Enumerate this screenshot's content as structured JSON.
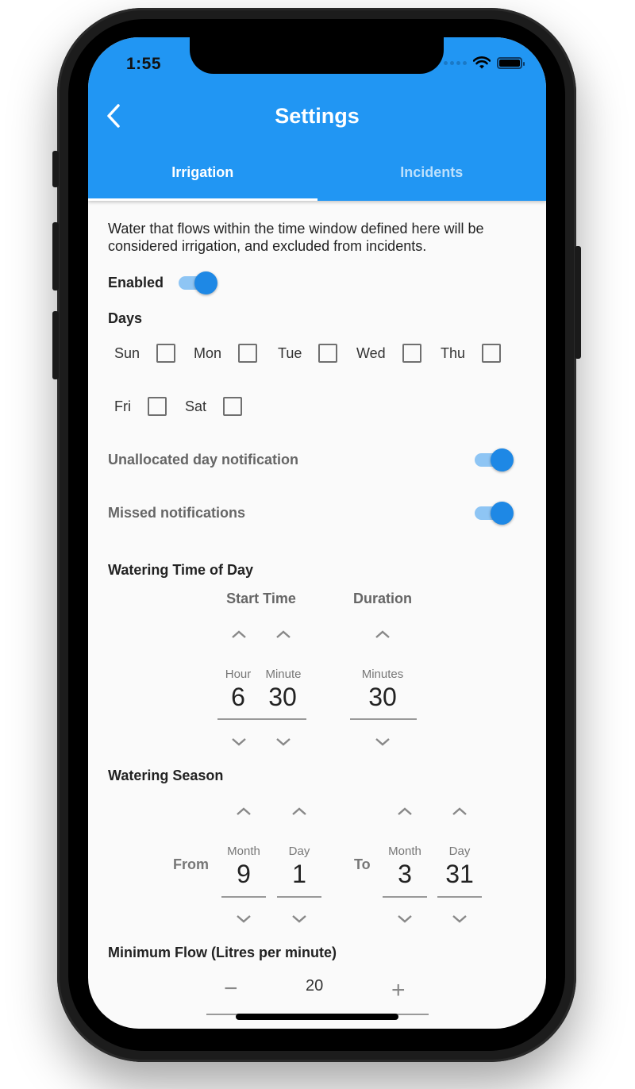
{
  "status_bar": {
    "time": "1:55"
  },
  "appbar": {
    "title": "Settings",
    "back_icon": "chevron-left-icon",
    "tabs": [
      {
        "label": "Irrigation",
        "active": true
      },
      {
        "label": "Incidents",
        "active": false
      }
    ]
  },
  "irrigation": {
    "description": "Water that flows within the time window defined here will be considered irrigation, and excluded from incidents.",
    "enabled": {
      "label": "Enabled",
      "value": true
    },
    "days": {
      "label": "Days",
      "items": [
        {
          "label": "Sun",
          "checked": false
        },
        {
          "label": "Mon",
          "checked": false
        },
        {
          "label": "Tue",
          "checked": false
        },
        {
          "label": "Wed",
          "checked": false
        },
        {
          "label": "Thu",
          "checked": false
        },
        {
          "label": "Fri",
          "checked": false
        },
        {
          "label": "Sat",
          "checked": false
        }
      ]
    },
    "unallocated_notification": {
      "label": "Unallocated day notification",
      "value": true
    },
    "missed_notifications": {
      "label": "Missed notifications",
      "value": true
    },
    "watering_time": {
      "label": "Watering Time of Day",
      "start_time": {
        "label": "Start Time",
        "hour_label": "Hour",
        "hour": "6",
        "minute_label": "Minute",
        "minute": "30"
      },
      "duration": {
        "label": "Duration",
        "minutes_label": "Minutes",
        "minutes": "30"
      }
    },
    "watering_season": {
      "label": "Watering Season",
      "from": {
        "label": "From",
        "month_label": "Month",
        "month": "9",
        "day_label": "Day",
        "day": "1"
      },
      "to": {
        "label": "To",
        "month_label": "Month",
        "month": "3",
        "day_label": "Day",
        "day": "31"
      }
    },
    "minimum_flow": {
      "label": "Minimum Flow (Litres per minute)",
      "value": "20",
      "decrement": "−",
      "increment": "+"
    }
  },
  "colors": {
    "primary": "#2196f3",
    "toggle_thumb": "#1e88e5",
    "toggle_track": "#8ec5f4",
    "background": "#fafafa"
  }
}
